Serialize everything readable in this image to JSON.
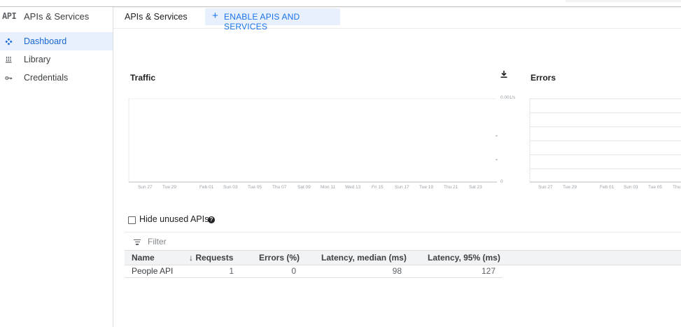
{
  "app": {
    "logo": "API",
    "title": "APIs & Services"
  },
  "sidebar": {
    "items": [
      {
        "label": "Dashboard",
        "icon": "dashboard-icon",
        "active": true
      },
      {
        "label": "Library",
        "icon": "library-icon",
        "active": false
      },
      {
        "label": "Credentials",
        "icon": "key-icon",
        "active": false
      }
    ]
  },
  "header": {
    "title": "APIs & Services",
    "enable_button": "ENABLE APIS AND SERVICES"
  },
  "traffic_chart": {
    "title": "Traffic",
    "y_top_label": "0.001/s",
    "y_bottom_label": "0",
    "x_labels": [
      "Sun 27",
      "Tue 29",
      "Feb 01",
      "Sun 03",
      "Tue 05",
      "Thu 07",
      "Sat 09",
      "Mon 11",
      "Wed 13",
      "Fri 15",
      "Sun 17",
      "Tue 19",
      "Thu 21",
      "Sat 23"
    ]
  },
  "errors_chart": {
    "title": "Errors",
    "x_labels": [
      "Sun 27",
      "Tue 29",
      "Feb 01",
      "Sun 03",
      "Tue 05",
      "Thu"
    ]
  },
  "hide_unused": {
    "label": "Hide unused APIs",
    "checked": false
  },
  "filter": {
    "placeholder": "Filter"
  },
  "table": {
    "columns": [
      "Name",
      "Requests",
      "Errors (%)",
      "Latency, median (ms)",
      "Latency, 95% (ms)"
    ],
    "sort_indicator": "↓",
    "rows": [
      {
        "name": "People API",
        "requests": "1",
        "errors": "0",
        "latency_median": "98",
        "latency_95": "127"
      }
    ]
  },
  "colors": {
    "accent": "#1a73e8",
    "active_bg": "#e8f0fe",
    "header_bg": "#f1f3f4"
  }
}
